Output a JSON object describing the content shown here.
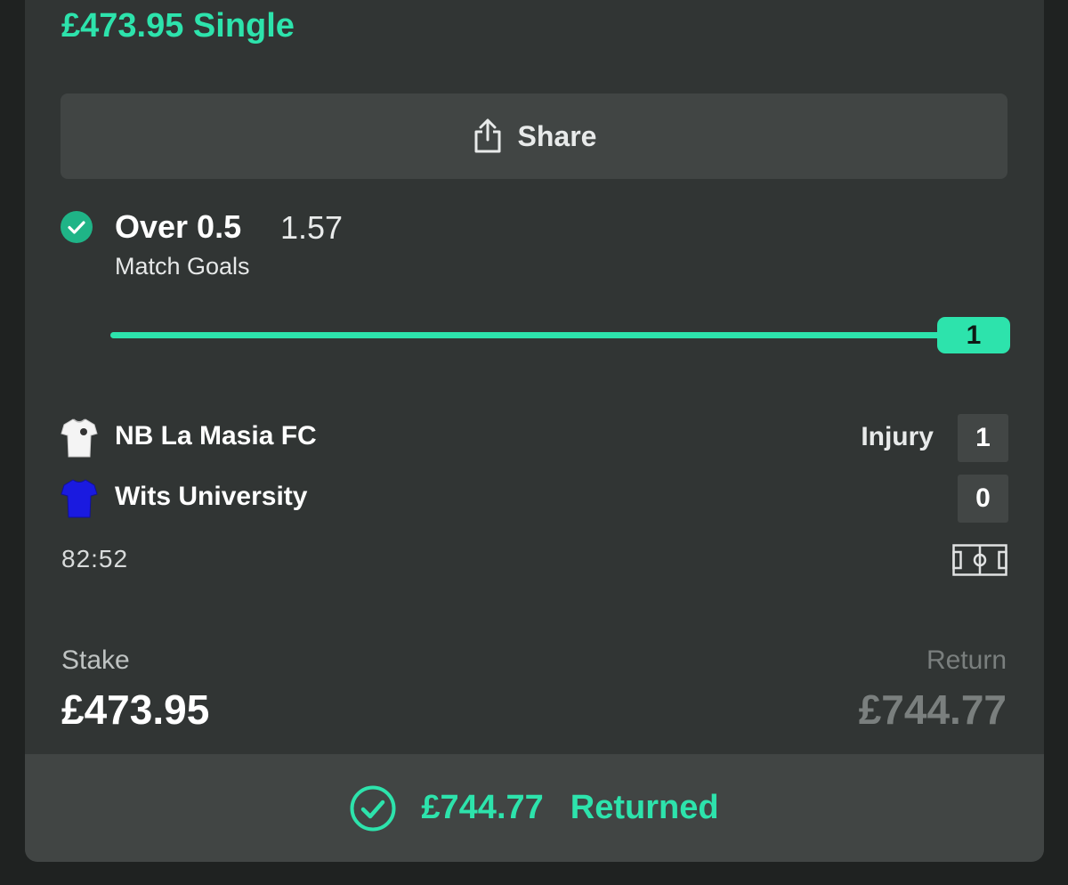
{
  "bet": {
    "title": "£473.95 Single",
    "share_label": "Share"
  },
  "selection": {
    "name": "Over 0.5",
    "odds": "1.57",
    "market": "Match Goals",
    "status": "won"
  },
  "progress": {
    "value": 1,
    "target": 1,
    "fraction": 1.0,
    "label": "1"
  },
  "match": {
    "home": {
      "name": "NB La Masia FC",
      "score": "1",
      "note": "Injury",
      "jersey_color": "#ffffff"
    },
    "away": {
      "name": "Wits University",
      "score": "0",
      "jersey_color": "#1a1ae0"
    },
    "clock": "82:52"
  },
  "totals": {
    "stake_label": "Stake",
    "stake_value": "£473.95",
    "return_label": "Return",
    "return_value": "£744.77"
  },
  "result": {
    "amount": "£744.77",
    "text": "Returned"
  },
  "colors": {
    "accent": "#2de3ac",
    "card": "#313534",
    "button": "#414544"
  },
  "icons": [
    "share-icon",
    "check-circle-icon",
    "jersey-icon",
    "pitch-icon"
  ]
}
